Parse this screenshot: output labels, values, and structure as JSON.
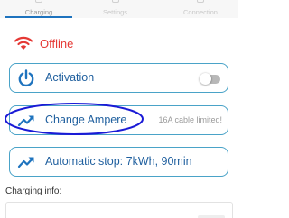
{
  "tabs": [
    {
      "label": "Charging",
      "active": true
    },
    {
      "label": "Settings",
      "active": false
    },
    {
      "label": "Connection",
      "active": false
    }
  ],
  "status": {
    "text": "Offline",
    "icon": "wifi-off-icon",
    "color": "#e53935"
  },
  "cards": {
    "activation": {
      "label": "Activation",
      "icon": "power-icon",
      "toggle_on": false
    },
    "ampere": {
      "label": "Change Ampere",
      "icon": "trend-icon",
      "note": "16A cable limited!"
    },
    "autostop": {
      "label": "Automatic stop: 7kWh, 90min",
      "icon": "trend-icon"
    }
  },
  "charging_info": {
    "title": "Charging info:"
  },
  "colors": {
    "accent": "#1e73be",
    "card_border": "#4aa3c8",
    "card_text": "#1f5f9e",
    "offline": "#e53935",
    "annotation": "#1a1ad6"
  }
}
